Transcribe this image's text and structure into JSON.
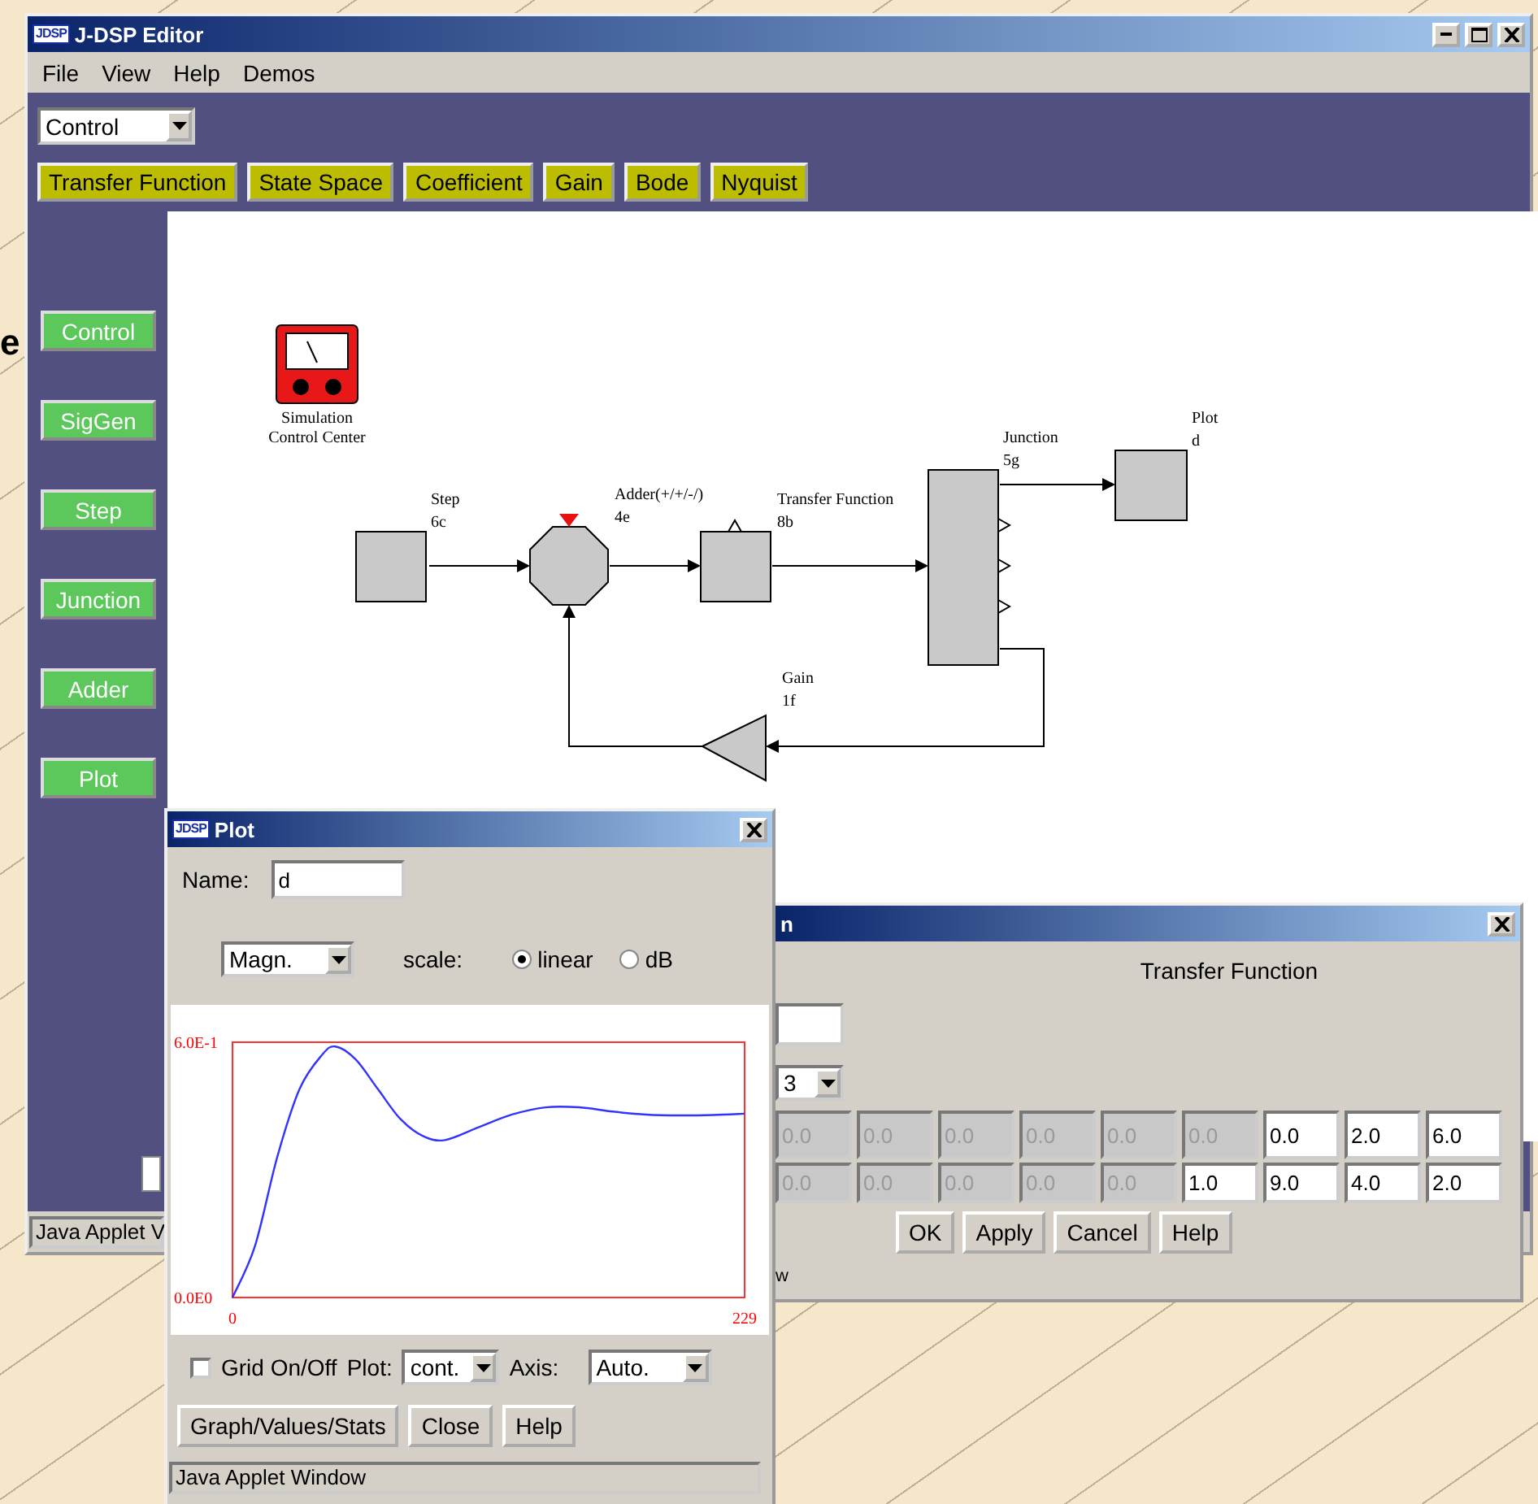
{
  "slide_text": "e",
  "editor": {
    "logo": "JDSP",
    "title": "J-DSP Editor",
    "menu": [
      "File",
      "View",
      "Help",
      "Demos"
    ],
    "category_select": "Control",
    "toolbar": [
      "Transfer Function",
      "State Space",
      "Coefficient",
      "Gain",
      "Bode",
      "Nyquist"
    ],
    "palette": [
      "Control",
      "SigGen",
      "Step",
      "Junction",
      "Adder",
      "Plot"
    ],
    "status": "Java Applet V",
    "diagram": {
      "monitor": {
        "label_lines": [
          "Simulation",
          "Control Center"
        ]
      },
      "blocks": [
        {
          "kind": "step",
          "name": "Step",
          "id": "6c"
        },
        {
          "kind": "adder",
          "name": "Adder(+/+/-/)",
          "id": "4e"
        },
        {
          "kind": "transfer",
          "name": "Transfer Function",
          "id": "8b"
        },
        {
          "kind": "junction",
          "name": "Junction",
          "id": "5g"
        },
        {
          "kind": "plot",
          "name": "Plot",
          "id": "d"
        },
        {
          "kind": "gain",
          "name": "Gain",
          "id": "1f"
        }
      ]
    }
  },
  "plot_window": {
    "logo": "JDSP",
    "title": "Plot",
    "name_label": "Name:",
    "name_value": "d",
    "mode_select": "Magn.",
    "scale_label": "scale:",
    "scale_options": [
      {
        "label": "linear",
        "selected": true
      },
      {
        "label": "dB",
        "selected": false
      }
    ],
    "chart_data": {
      "type": "line",
      "x": [
        0,
        10,
        20,
        30,
        40,
        46,
        55,
        65,
        75,
        85,
        95,
        110,
        125,
        140,
        155,
        170,
        185,
        200,
        215,
        229
      ],
      "series": [
        {
          "color": "#3333ff",
          "values": [
            0,
            0.12,
            0.33,
            0.49,
            0.57,
            0.59,
            0.56,
            0.49,
            0.42,
            0.38,
            0.37,
            0.4,
            0.43,
            0.447,
            0.447,
            0.437,
            0.43,
            0.428,
            0.429,
            0.432
          ]
        }
      ],
      "xlim": [
        0,
        229
      ],
      "ylim": [
        0,
        0.6
      ],
      "xticks": [
        0,
        229
      ],
      "yticks": [
        {
          "value": 0,
          "label": "0.0E0"
        },
        {
          "value": 0.6,
          "label": "6.0E-1"
        }
      ]
    },
    "grid": {
      "label": "Grid On/Off",
      "checked": false
    },
    "plot_label": "Plot:",
    "plot_select": "cont.",
    "axis_label": "Axis:",
    "axis_select": "Auto.",
    "buttons": [
      "Graph/Values/Stats",
      "Close",
      "Help"
    ],
    "status": "Java Applet Window"
  },
  "tf_dialog": {
    "title": "n",
    "heading": "Transfer Function",
    "order_select": "3",
    "coefficient_rows": [
      [
        {
          "value": "0.0",
          "disabled": true
        },
        {
          "value": "0.0",
          "disabled": true
        },
        {
          "value": "0.0",
          "disabled": true
        },
        {
          "value": "0.0",
          "disabled": true
        },
        {
          "value": "0.0",
          "disabled": true
        },
        {
          "value": "0.0",
          "disabled": true
        },
        {
          "value": "0.0",
          "disabled": false
        },
        {
          "value": "2.0",
          "disabled": false
        },
        {
          "value": "6.0",
          "disabled": false
        }
      ],
      [
        {
          "value": "0.0",
          "disabled": true
        },
        {
          "value": "0.0",
          "disabled": true
        },
        {
          "value": "0.0",
          "disabled": true
        },
        {
          "value": "0.0",
          "disabled": true
        },
        {
          "value": "0.0",
          "disabled": true
        },
        {
          "value": "1.0",
          "disabled": false
        },
        {
          "value": "9.0",
          "disabled": false
        },
        {
          "value": "4.0",
          "disabled": false
        },
        {
          "value": "2.0",
          "disabled": false
        }
      ]
    ],
    "buttons": [
      "OK",
      "Apply",
      "Cancel",
      "Help"
    ],
    "status": "w"
  }
}
